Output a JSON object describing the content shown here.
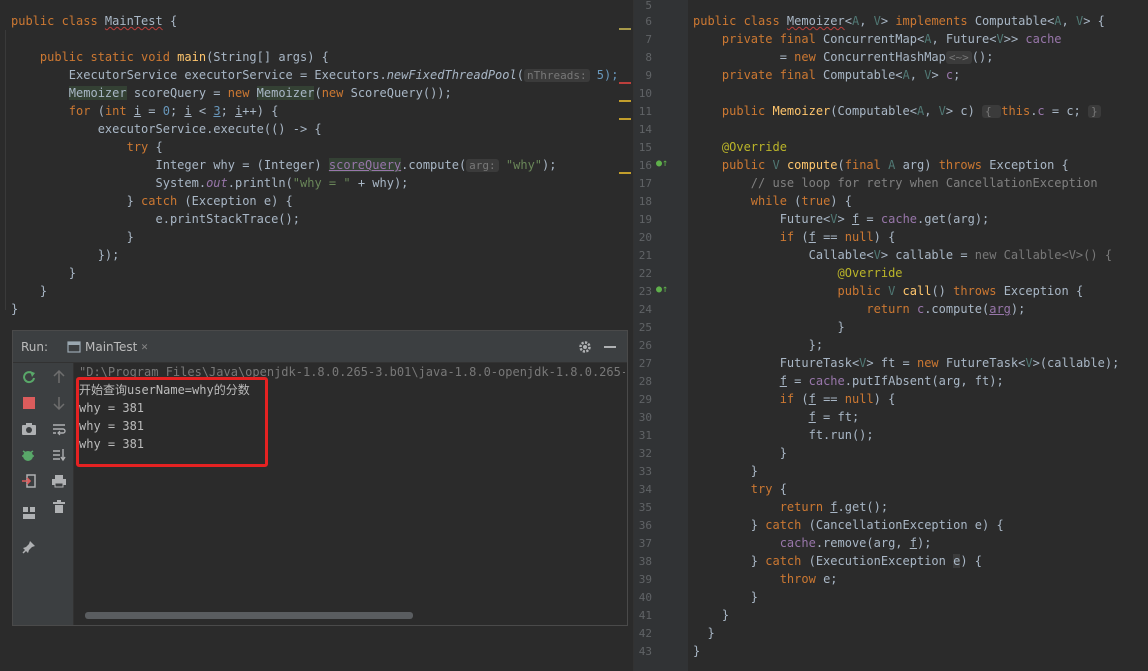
{
  "left_editor": {
    "lines": [
      [
        "public class ",
        "MainTest",
        " {"
      ],
      [
        ""
      ],
      [
        "    public static void ",
        "main",
        "(String[] args) {"
      ],
      [
        "        ExecutorService executorService = Executors.",
        "newFixedThreadPool",
        "(",
        "nThreads:",
        " 5);"
      ],
      [
        "        ",
        "Memoizer",
        " scoreQuery = ",
        "new ",
        "Memoizer",
        "(",
        "new ",
        "ScoreQuery());"
      ],
      [
        "        ",
        "for ",
        "(",
        "int ",
        "i",
        " = ",
        "0",
        "; ",
        "i",
        " < ",
        "3",
        "; ",
        "i",
        "++) {"
      ],
      [
        "            executorService.execute(() -> {"
      ],
      [
        "                ",
        "try",
        " {"
      ],
      [
        "                    Integer why = (Integer) ",
        "scoreQuery",
        ".compute(",
        "arg:",
        " ",
        "\"why\"",
        ");"
      ],
      [
        "                    System.",
        "out",
        ".println(",
        "\"why = \"",
        " + why);"
      ],
      [
        "                } ",
        "catch",
        " (Exception e) {"
      ],
      [
        "                    e.printStackTrace();"
      ],
      [
        "                }"
      ],
      [
        "            });"
      ],
      [
        "        }"
      ],
      [
        "    }"
      ],
      [
        "}"
      ]
    ]
  },
  "right_editor": {
    "line_numbers": [
      "5",
      "6",
      "7",
      "8",
      "9",
      "10",
      "11",
      "14",
      "15",
      "16",
      "17",
      "18",
      "19",
      "20",
      "21",
      "22",
      "23",
      "24",
      "25",
      "26",
      "27",
      "28",
      "29",
      "30",
      "31",
      "32",
      "33",
      "34",
      "35",
      "36",
      "37",
      "38",
      "39",
      "40",
      "41",
      "42",
      "43"
    ],
    "lines": [
      [
        ""
      ],
      [
        "public class ",
        "Memoizer",
        "<",
        "A",
        ", ",
        "V",
        "> ",
        "implements ",
        "Computable",
        "<",
        "A",
        ", ",
        "V",
        "> {"
      ],
      [
        "    private final ",
        "ConcurrentMap",
        "<",
        "A",
        ", ",
        "Future",
        "<",
        "V",
        ">> ",
        "cache"
      ],
      [
        "            = ",
        "new ",
        "ConcurrentHashMap",
        "<~>",
        "();"
      ],
      [
        "    private final ",
        "Computable",
        "<",
        "A",
        ", ",
        "V",
        "> ",
        "c",
        ";"
      ],
      [
        ""
      ],
      [
        "    public ",
        "Memoizer",
        "(Computable<",
        "A",
        ", ",
        "V",
        "> c) ",
        "{ ",
        "this",
        ".",
        "c",
        " = c; ",
        "}"
      ],
      [
        ""
      ],
      [
        "    ",
        "@Override"
      ],
      [
        "    public ",
        "V ",
        "compute",
        "(",
        "final ",
        "A ",
        "arg) ",
        "throws ",
        "Exception {"
      ],
      [
        "        ",
        "// use loop for retry when CancellationException"
      ],
      [
        "        ",
        "while ",
        "(",
        "true",
        ") {"
      ],
      [
        "            Future<",
        "V",
        "> ",
        "f",
        " = ",
        "cache",
        ".get(arg);"
      ],
      [
        "            ",
        "if ",
        "(",
        "f",
        " == ",
        "null",
        ") {"
      ],
      [
        "                Callable<",
        "V",
        "> callable = ",
        "new Callable<V>() {"
      ],
      [
        "                    ",
        "@Override"
      ],
      [
        "                    ",
        "public ",
        "V ",
        "call",
        "() ",
        "throws ",
        "Exception {"
      ],
      [
        "                        ",
        "return ",
        "c",
        ".compute(",
        "arg",
        ");"
      ],
      [
        "                    }"
      ],
      [
        "                };"
      ],
      [
        "            FutureTask<",
        "V",
        "> ft = ",
        "new ",
        "FutureTask<",
        "V",
        ">(callable);"
      ],
      [
        "            ",
        "f",
        " = ",
        "cache",
        ".putIfAbsent(arg, ft);"
      ],
      [
        "            ",
        "if ",
        "(",
        "f",
        " == ",
        "null",
        ") {"
      ],
      [
        "                ",
        "f",
        " = ft;"
      ],
      [
        "                ft.run();"
      ],
      [
        "            }"
      ],
      [
        "        }"
      ],
      [
        "        ",
        "try",
        " {"
      ],
      [
        "            ",
        "return ",
        "f",
        ".get();"
      ],
      [
        "        } ",
        "catch ",
        "(CancellationException e) {"
      ],
      [
        "            ",
        "cache",
        ".remove(arg, ",
        "f",
        ");"
      ],
      [
        "        } ",
        "catch ",
        "(ExecutionException ",
        "e",
        ") {"
      ],
      [
        "            ",
        "throw ",
        "e;"
      ],
      [
        "        }"
      ],
      [
        "    }"
      ],
      [
        "  }"
      ],
      [
        "}"
      ]
    ]
  },
  "run_panel": {
    "label": "Run:",
    "tab_label": "MainTest",
    "console_lines": [
      "\"D:\\Program Files\\Java\\openjdk-1.8.0.265-3.b01\\java-1.8.0-openjdk-1.8.0.265-3",
      "开始查询userName=why的分数",
      "why = 381",
      "why = 381",
      "why = 381"
    ]
  },
  "icons": {
    "rerun": "rerun-icon",
    "stop": "stop-icon",
    "camera": "camera-icon",
    "debug": "debug-icon",
    "exit": "exit-icon",
    "layout": "layout-icon",
    "pin": "pin-icon",
    "up": "arrow-up-icon",
    "down": "arrow-down-icon",
    "wrap": "soft-wrap-icon",
    "scroll-end": "scroll-to-end-icon",
    "print": "print-icon",
    "trash": "trash-icon",
    "gear": "gear-icon",
    "minimize": "minimize-icon"
  },
  "colors": {
    "editor_bg": "#2b2b2b",
    "keyword": "#cc7832",
    "function": "#ffc66d",
    "string": "#6a8759",
    "number": "#6897bb",
    "field": "#9876aa",
    "annotation": "#bbb529",
    "highlight_box": "#e52222"
  }
}
